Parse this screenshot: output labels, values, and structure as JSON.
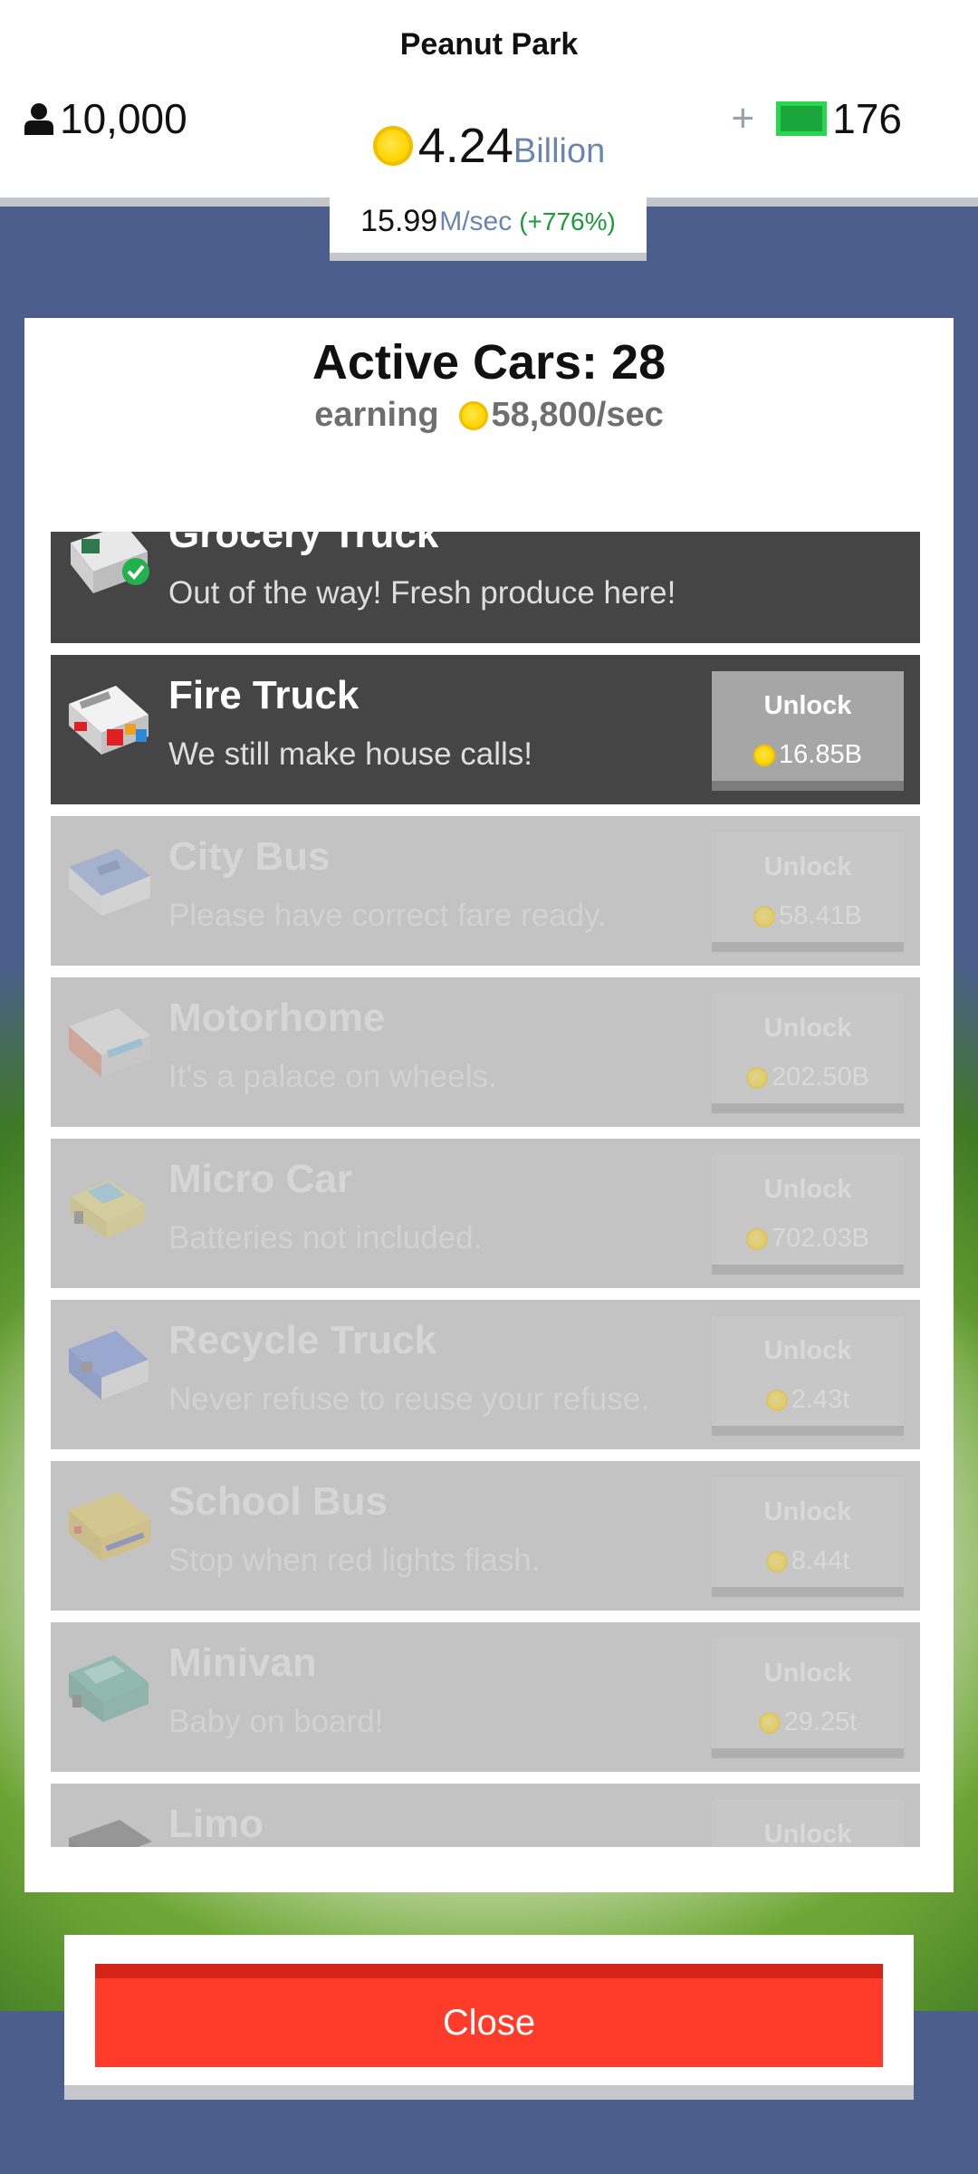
{
  "header": {
    "park_name": "Peanut Park",
    "population": "10,000",
    "cash_value": "4.24",
    "cash_unit": "Billion",
    "gems_plus": "+",
    "gems": "176",
    "rate_value": "15.99",
    "rate_unit": "M/sec",
    "rate_change": "(+776%)"
  },
  "panel": {
    "title": "Active Cars: 28",
    "earning_label": "earning",
    "earning_value": "58,800/sec"
  },
  "cars": [
    {
      "name": "Grocery Truck",
      "desc": "Out of the way! Fresh produce here!",
      "status": "owned",
      "icon": "grocery-truck-icon"
    },
    {
      "name": "Fire Truck",
      "desc": "We still make house calls!",
      "status": "available",
      "unlock": "Unlock",
      "price": "16.85B",
      "icon": "fire-truck-icon"
    },
    {
      "name": "City Bus",
      "desc": "Please have correct fare ready.",
      "status": "locked",
      "unlock": "Unlock",
      "price": "58.41B",
      "icon": "city-bus-icon"
    },
    {
      "name": "Motorhome",
      "desc": "It's a palace on wheels.",
      "status": "locked",
      "unlock": "Unlock",
      "price": "202.50B",
      "icon": "motorhome-icon"
    },
    {
      "name": "Micro Car",
      "desc": "Batteries not included.",
      "status": "locked",
      "unlock": "Unlock",
      "price": "702.03B",
      "icon": "micro-car-icon"
    },
    {
      "name": "Recycle Truck",
      "desc": "Never refuse to reuse your refuse.",
      "status": "locked",
      "unlock": "Unlock",
      "price": "2.43t",
      "icon": "recycle-truck-icon"
    },
    {
      "name": "School Bus",
      "desc": "Stop when red lights flash.",
      "status": "locked",
      "unlock": "Unlock",
      "price": "8.44t",
      "icon": "school-bus-icon"
    },
    {
      "name": "Minivan",
      "desc": "Baby on board!",
      "status": "locked",
      "unlock": "Unlock",
      "price": "29.25t",
      "icon": "minivan-icon"
    },
    {
      "name": "Limo",
      "desc": "",
      "status": "locked",
      "unlock": "Unlock",
      "price": "",
      "icon": "limo-icon"
    }
  ],
  "close_label": "Close",
  "colors": {
    "background": "#4b5e8c",
    "row_active": "#454545",
    "row_locked": "#c3c3c3",
    "close_button": "#ff3b2a",
    "coin": "#ffd400",
    "gem": "#26d94c",
    "rate_change": "#1a9a3a"
  }
}
